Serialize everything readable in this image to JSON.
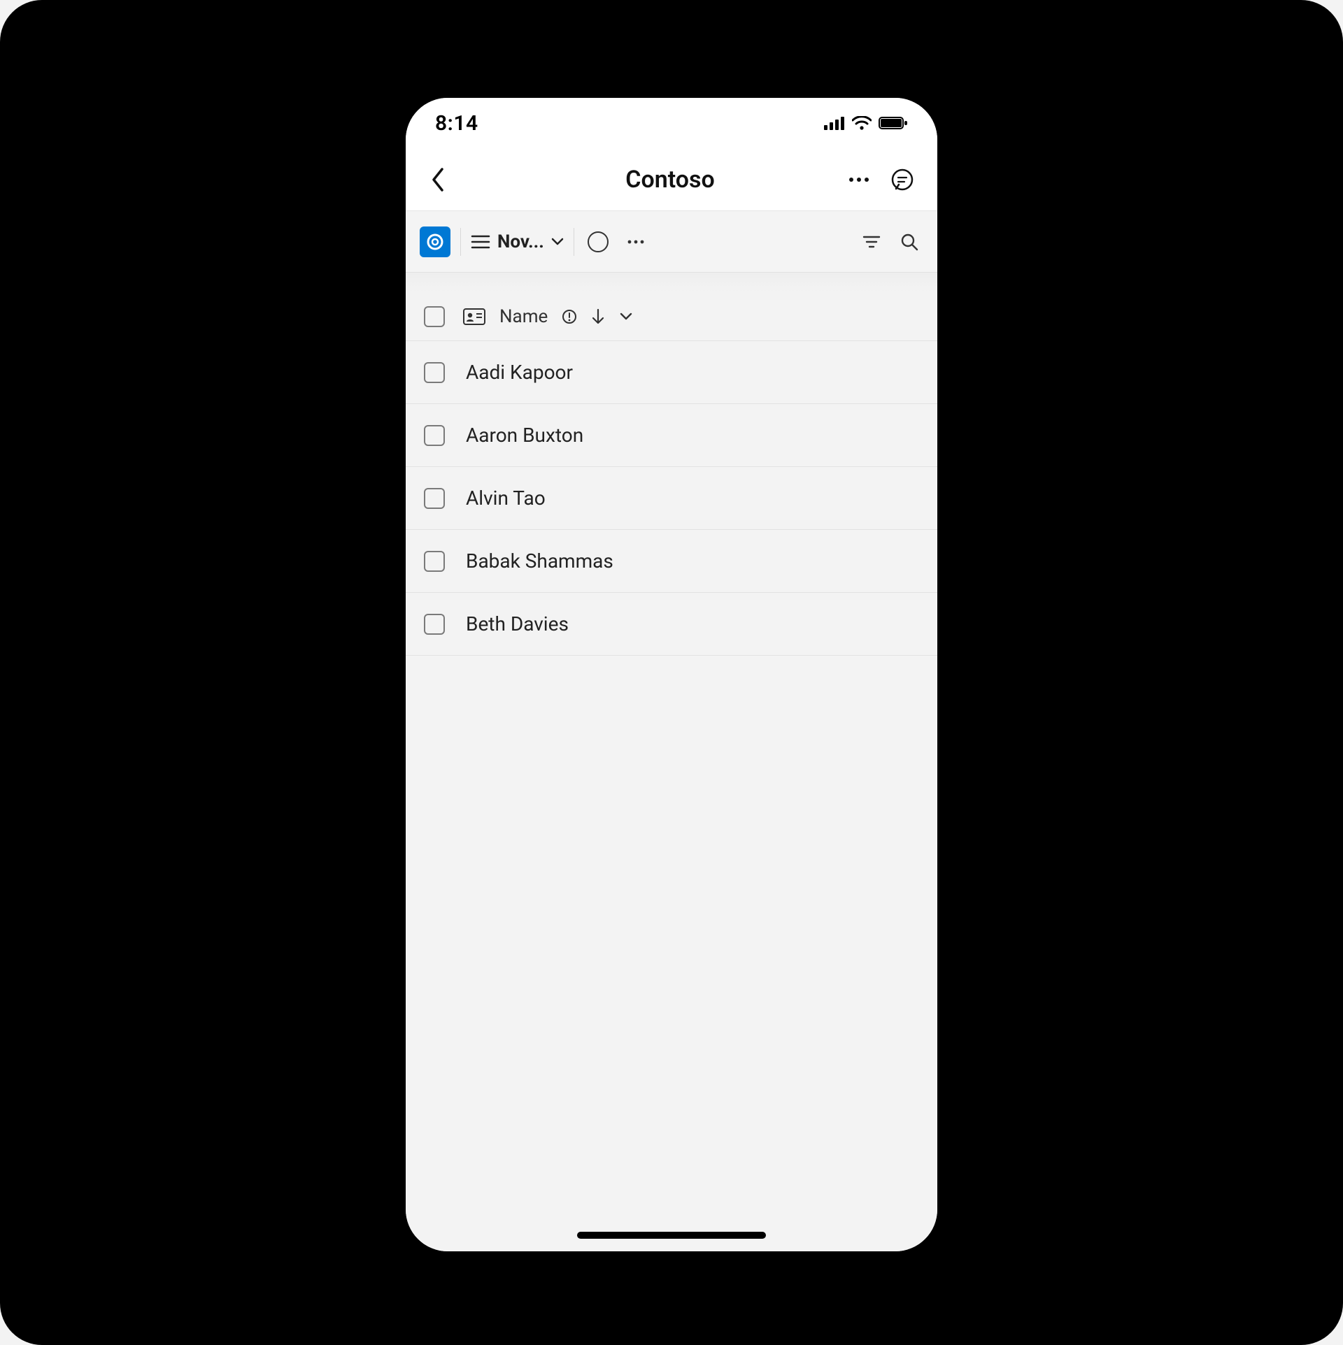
{
  "status": {
    "time": "8:14"
  },
  "nav": {
    "title": "Contoso"
  },
  "command": {
    "view_label": "Nov..."
  },
  "list": {
    "column_label": "Name",
    "rows": [
      {
        "name": "Aadi Kapoor"
      },
      {
        "name": "Aaron Buxton"
      },
      {
        "name": "Alvin Tao"
      },
      {
        "name": "Babak Shammas"
      },
      {
        "name": "Beth Davies"
      }
    ]
  }
}
